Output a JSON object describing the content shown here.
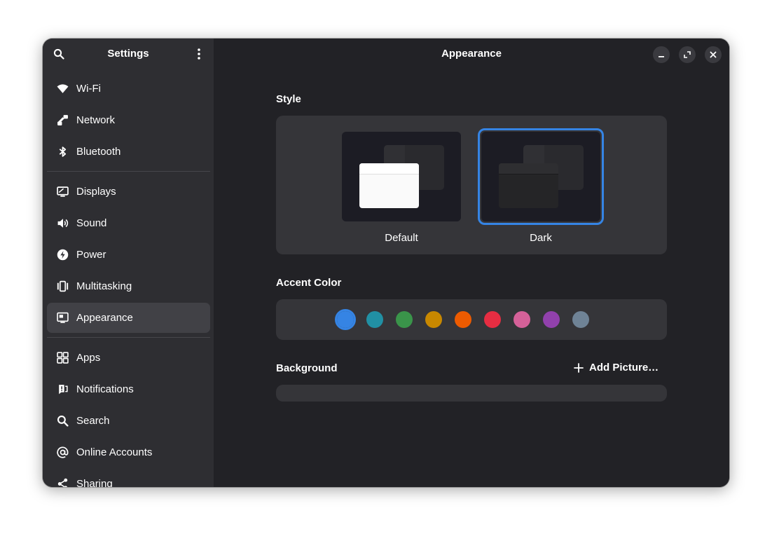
{
  "app": {
    "title": "Settings"
  },
  "sidebar": {
    "groups": [
      [
        {
          "id": "wifi",
          "label": "Wi-Fi",
          "icon": "wifi-icon"
        },
        {
          "id": "network",
          "label": "Network",
          "icon": "network-icon"
        },
        {
          "id": "bluetooth",
          "label": "Bluetooth",
          "icon": "bluetooth-icon"
        }
      ],
      [
        {
          "id": "displays",
          "label": "Displays",
          "icon": "display-icon"
        },
        {
          "id": "sound",
          "label": "Sound",
          "icon": "speaker-icon"
        },
        {
          "id": "power",
          "label": "Power",
          "icon": "power-icon"
        },
        {
          "id": "multitasking",
          "label": "Multitasking",
          "icon": "multitasking-icon"
        },
        {
          "id": "appearance",
          "label": "Appearance",
          "icon": "appearance-icon",
          "active": true
        }
      ],
      [
        {
          "id": "apps",
          "label": "Apps",
          "icon": "apps-grid-icon"
        },
        {
          "id": "notifications",
          "label": "Notifications",
          "icon": "notifications-icon"
        },
        {
          "id": "search",
          "label": "Search",
          "icon": "search-icon"
        },
        {
          "id": "online-accounts",
          "label": "Online Accounts",
          "icon": "at-sign-icon"
        },
        {
          "id": "sharing",
          "label": "Sharing",
          "icon": "share-icon"
        }
      ]
    ]
  },
  "main": {
    "title": "Appearance",
    "style": {
      "heading": "Style",
      "options": [
        {
          "id": "default",
          "label": "Default",
          "selected": false
        },
        {
          "id": "dark",
          "label": "Dark",
          "selected": true
        }
      ]
    },
    "accent": {
      "heading": "Accent Color",
      "selected_index": 0,
      "colors": [
        "#3584e4",
        "#2190a4",
        "#3a944a",
        "#c88800",
        "#ed5b00",
        "#e62d42",
        "#d56199",
        "#9141ac",
        "#6f8396"
      ]
    },
    "background": {
      "heading": "Background",
      "add_label": "Add Picture…"
    }
  },
  "theme": {
    "accent": "#3584e4",
    "window_bg": "#222226",
    "sidebar_bg": "#2e2e32",
    "card_bg": "#353539"
  }
}
